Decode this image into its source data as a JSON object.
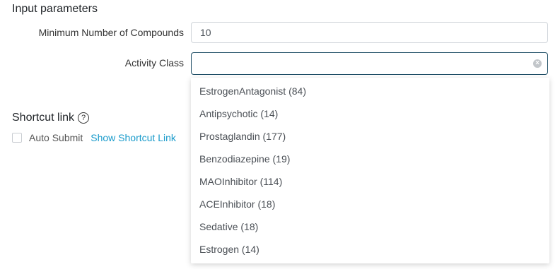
{
  "input_section": {
    "title": "Input parameters"
  },
  "min_compounds": {
    "label": "Minimum Number of Compounds",
    "value": "10"
  },
  "activity_class": {
    "label": "Activity Class",
    "value": "",
    "options": [
      "EstrogenAntagonist (84)",
      "Antipsychotic (14)",
      "Prostaglandin (177)",
      "Benzodiazepine (19)",
      "MAOInhibitor (114)",
      "ACEInhibitor (18)",
      "Sedative (18)",
      "Estrogen (14)"
    ]
  },
  "shortcut_section": {
    "title": "Shortcut link",
    "help_icon": "?",
    "auto_submit_label": "Auto Submit",
    "auto_submit_checked": false,
    "show_link_label": "Show Shortcut Link"
  },
  "colors": {
    "link": "#1a9bcb",
    "focus_border": "#1f4e66"
  }
}
